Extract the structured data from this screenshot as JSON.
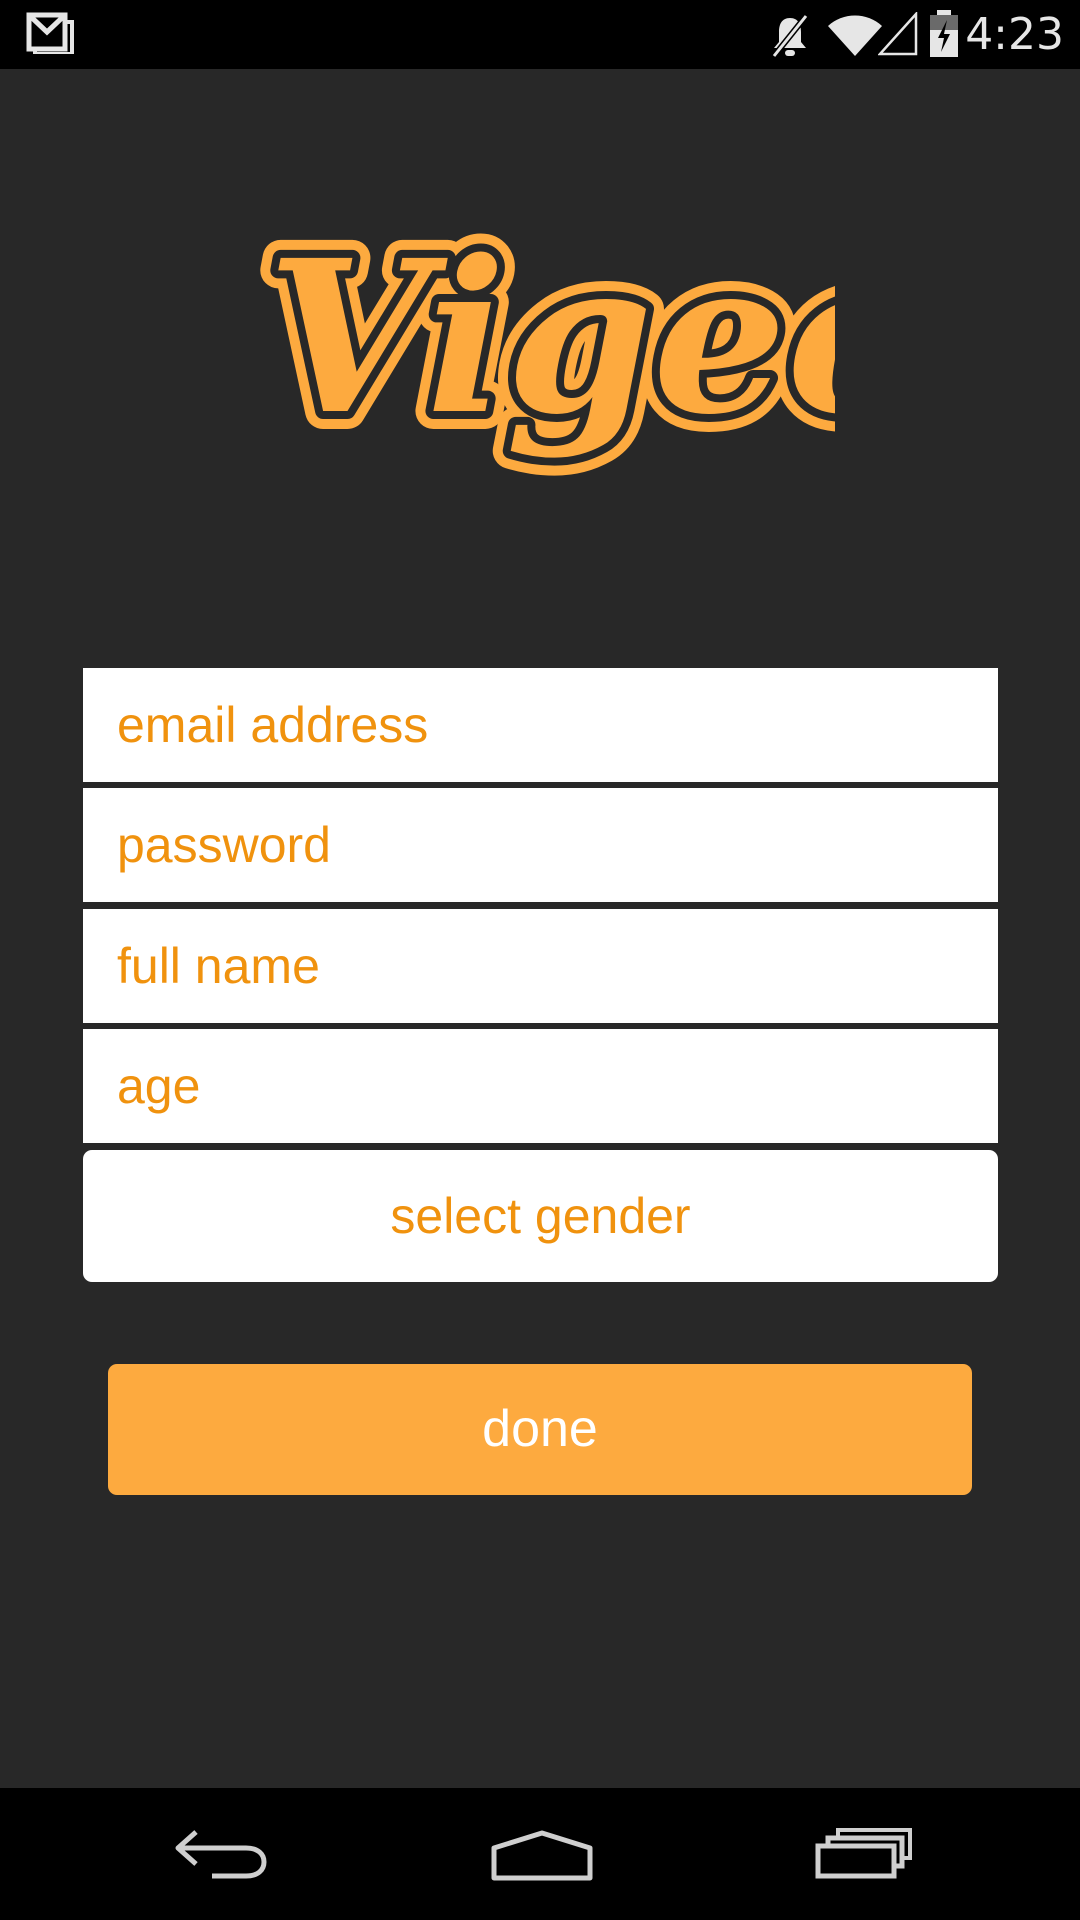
{
  "status_bar": {
    "time": "4:23",
    "icons": [
      "gmail-icon",
      "mute-icon",
      "wifi-icon",
      "signal-icon",
      "battery-icon"
    ]
  },
  "logo": {
    "text": "Vigeo",
    "fill_color": "#fdaa3f",
    "outline_color": "#282828"
  },
  "form": {
    "email_placeholder": "email address",
    "password_placeholder": "password",
    "full_name_placeholder": "full name",
    "age_placeholder": "age",
    "gender_button_label": "select gender",
    "done_button_label": "done"
  },
  "colors": {
    "background": "#282828",
    "accent": "#fdaa3f",
    "field_text": "#f0920e",
    "bars": "#000000"
  },
  "nav_bar": {
    "icons": [
      "back-icon",
      "home-icon",
      "recent-apps-icon"
    ]
  }
}
